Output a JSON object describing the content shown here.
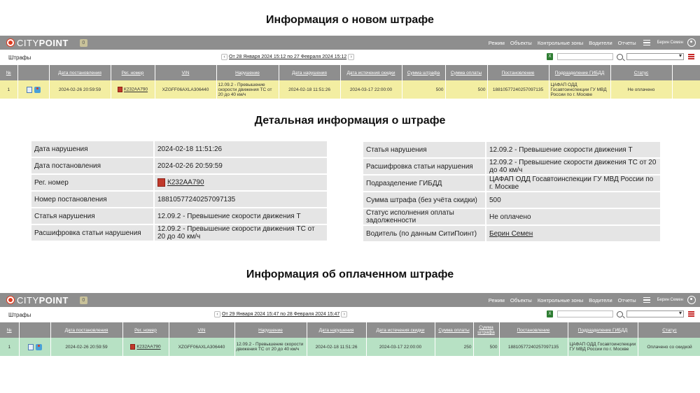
{
  "titles": {
    "new_fine": "Информация о новом штрафе",
    "detail": "Детальная информация о штрафе",
    "paid_fine": "Информация об оплаченном штрафе"
  },
  "app": {
    "logo_light": "CITY",
    "logo_bold": "POINT",
    "badge": "0",
    "nav": [
      "Режим",
      "Объекты",
      "Контрольные зоны",
      "Водители",
      "Отчеты"
    ],
    "user": "Берин Семен",
    "page_title": "Штрафы",
    "icons": [
      "hamburger-icon",
      "user-icon",
      "excel-icon",
      "search-icon",
      "list-icon"
    ]
  },
  "columns": [
    "№",
    "",
    "Дата постановления",
    "Рег. номер",
    "VIN",
    "Нарушение",
    "Дата нарушения",
    "Дата истечения скидки",
    "Сумма штрафа",
    "Сумма оплаты",
    "Постановление",
    "Подразделение ГИБДД",
    "Статус"
  ],
  "columns_paid": [
    "№",
    "",
    "Дата постановления",
    "Рег. номер",
    "VIN",
    "Нарушение",
    "Дата нарушения",
    "Дата истечения скидки",
    "Сумма оплаты",
    "Сумма штрафа",
    "Постановление",
    "Подразделение ГИБДД",
    "Статус"
  ],
  "new_fine": {
    "daterange": "От 28 Января 2024 15:12 по 27 Февраля 2024 15:12",
    "row": {
      "num": "1",
      "decision_date": "2024-02-26 20:59:59",
      "plate": "К232АА790",
      "vin": "XZGFF06AXLA306440",
      "violation": "12.09.2 - Превышение скорости движения ТС от 20 до 40 км/ч",
      "violation_date": "2024-02-18 11:51:26",
      "discount_until": "2024-03-17 22:00:00",
      "fine_sum": "500",
      "paid_sum": "500",
      "decision_no": "18810577240257097135",
      "department": "ЦАФАП ОДД Госавтоинспекции ГУ МВД России по г. Москве",
      "status": "Не оплачено"
    }
  },
  "detail_left": [
    {
      "label": "Дата нарушения",
      "value": "2024-02-18 11:51:26"
    },
    {
      "label": "Дата постановления",
      "value": "2024-02-26 20:59:59"
    },
    {
      "label": "Рег. номер",
      "value": "К232АА790"
    },
    {
      "label": "Номер постановления",
      "value": "18810577240257097135"
    },
    {
      "label": "Статья нарушения",
      "value": "12.09.2 - Превышение скорости движения Т"
    },
    {
      "label": "Расшифровка статьи нарушения",
      "value": "12.09.2 - Превышение скорости движения ТС от 20 до 40 км/ч"
    }
  ],
  "detail_right": [
    {
      "label": "Статья нарушения",
      "value": "12.09.2 - Превышение скорости движения Т"
    },
    {
      "label": "Расшифровка статьи нарушения",
      "value": "12.09.2 - Превышение скорости движения ТС от 20 до 40 км/ч"
    },
    {
      "label": "Подразделение ГИБДД",
      "value": "ЦАФАП ОДД Госавтоинспекции ГУ МВД России по г. Москве"
    },
    {
      "label": "Сумма штрафа (без учёта скидки)",
      "value": "500"
    },
    {
      "label": "Статус исполнения оплаты задолженности",
      "value": "Не оплачено"
    },
    {
      "label": "Водитель (по данным СитиПоинт)",
      "value": "Берин Семен"
    }
  ],
  "paid_fine": {
    "daterange": "От 29 Января 2024 15:47 по 28 Февраля 2024 15:47",
    "row": {
      "num": "1",
      "decision_date": "2024-02-26 20:59:59",
      "plate": "К232АА790",
      "vin": "XZGFF06AXLA306440",
      "violation": "12.09.2 - Превышение скорости движения ТС от 20 до 40 км/ч",
      "violation_date": "2024-02-18 11:51:26",
      "discount_until": "2024-03-17 22:00:00",
      "paid_sum": "250",
      "fine_sum": "500",
      "decision_no": "18810577240257097135",
      "department": "ЦАФАП ОДД Госавтоинспекции ГУ МВД России по г. Москве",
      "status": "Оплачено со скидкой"
    }
  },
  "colors": {
    "topbar": "#8e8e8e",
    "row_unpaid": "#f3eea2",
    "row_paid": "#b7e1c4",
    "logo_accent": "#e03a1e"
  }
}
